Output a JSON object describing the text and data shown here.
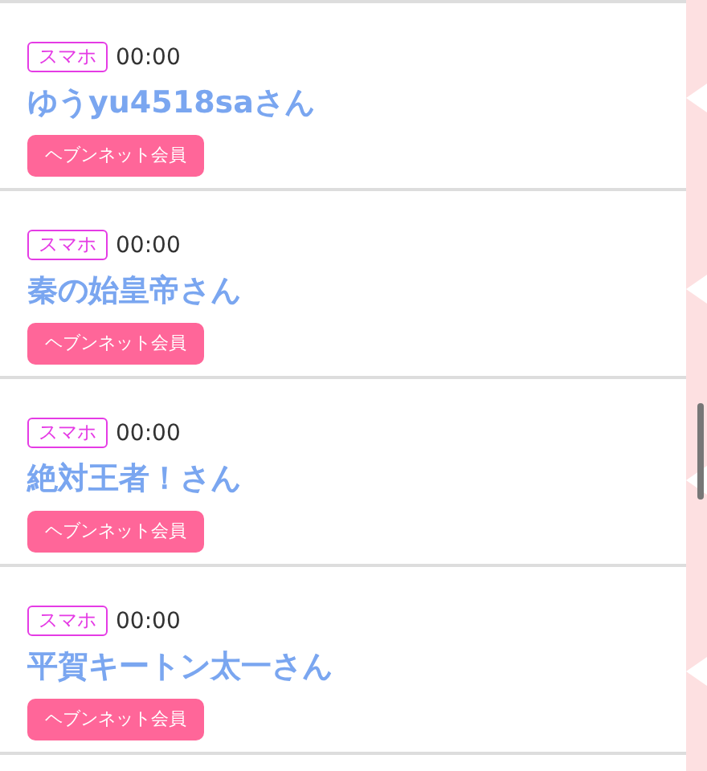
{
  "users": [
    {
      "device": "スマホ",
      "time": "00:00",
      "name": "ゆうyu4518saさん",
      "badge": "ヘブンネット会員"
    },
    {
      "device": "スマホ",
      "time": "00:00",
      "name": "秦の始皇帝さん",
      "badge": "ヘブンネット会員"
    },
    {
      "device": "スマホ",
      "time": "00:00",
      "name": "絶対王者！さん",
      "badge": "ヘブンネット会員"
    },
    {
      "device": "スマホ",
      "time": "00:00",
      "name": "平賀キートン太一さん",
      "badge": "ヘブンネット会員"
    }
  ]
}
